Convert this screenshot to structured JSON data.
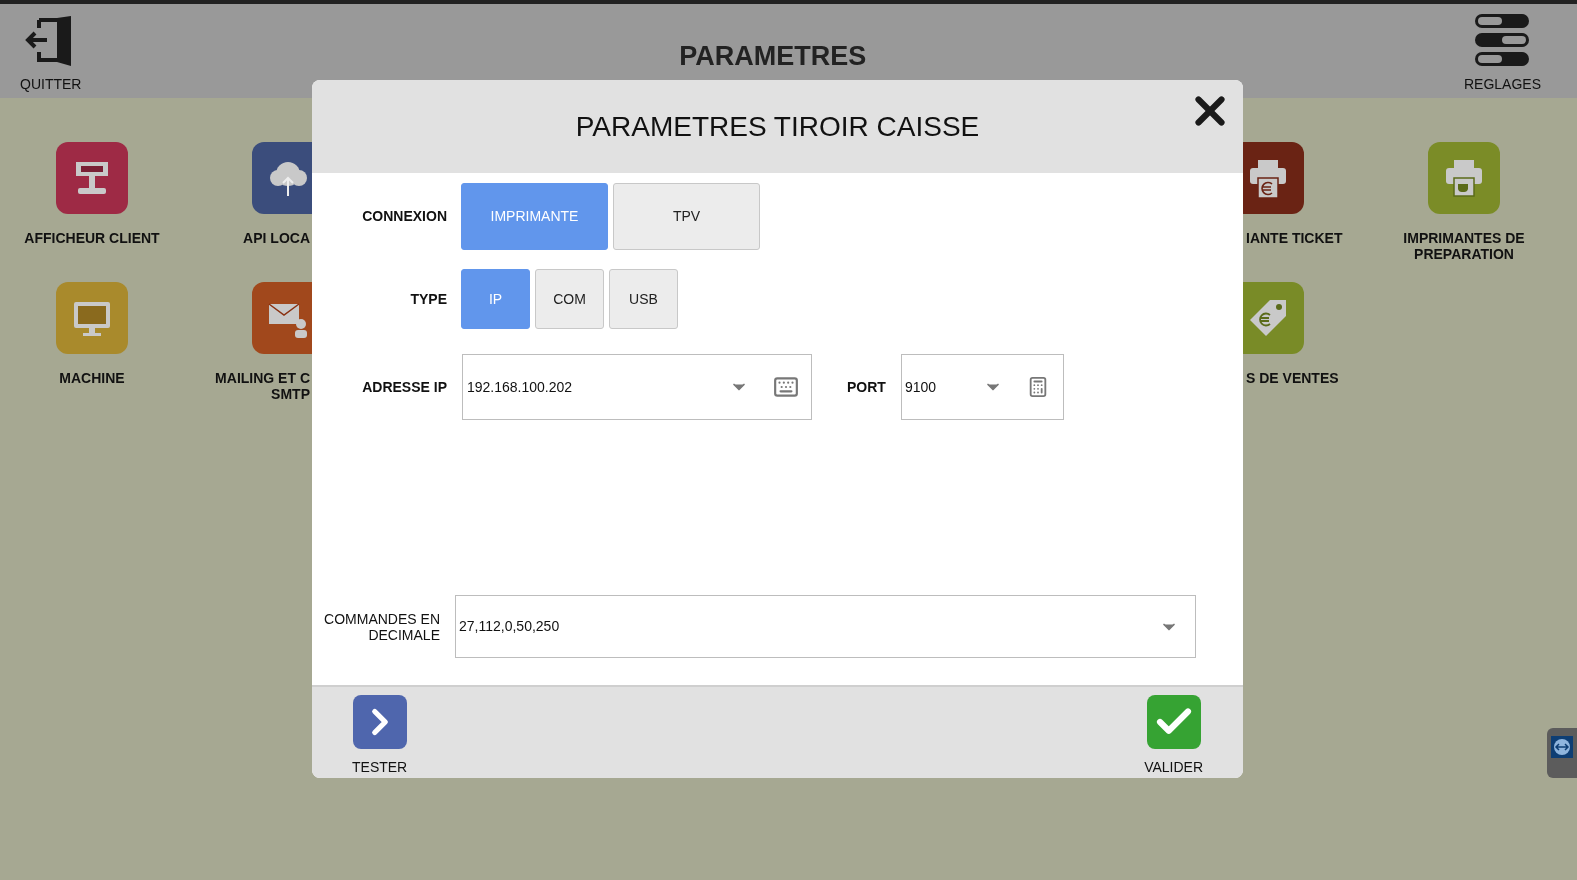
{
  "header": {
    "quit_label": "QUITTER",
    "title": "PARAMETRES",
    "settings_label": "REGLAGES"
  },
  "tile_rows": [
    {
      "left": [
        {
          "label": "AFFICHEUR CLIENT",
          "color": "#9e2a45"
        },
        {
          "label": "API LOCA",
          "color": "#3b4d7c"
        }
      ],
      "right": [
        {
          "label": "IANTE TICKET",
          "color": "#6a2314"
        },
        {
          "label": "IMPRIMANTES DE PREPARATION",
          "color": "#7b8c27"
        }
      ]
    },
    {
      "left": [
        {
          "label": "MACHINE",
          "color": "#a98a2c"
        },
        {
          "label": "MAILING ET C SMTP",
          "color": "#a1481c"
        }
      ],
      "right": [
        {
          "label": "S DE VENTES",
          "color": "#798b27"
        }
      ]
    }
  ],
  "dialog": {
    "title": "PARAMETRES TIROIR CAISSE",
    "connexion": {
      "label": "CONNEXION",
      "options": [
        {
          "label": "IMPRIMANTE",
          "selected": true
        },
        {
          "label": "TPV",
          "selected": false
        }
      ]
    },
    "type": {
      "label": "TYPE",
      "options": [
        {
          "label": "IP",
          "selected": true
        },
        {
          "label": "COM",
          "selected": false
        },
        {
          "label": "USB",
          "selected": false
        }
      ]
    },
    "ip": {
      "label": "ADRESSE IP",
      "value": "192.168.100.202"
    },
    "port": {
      "label": "PORT",
      "value": "9100"
    },
    "commands": {
      "label": "COMMANDES EN DECIMALE",
      "value": "27,112,0,50,250"
    },
    "footer_buttons": [
      {
        "kind": "test",
        "label": "TESTER"
      },
      {
        "kind": "validate",
        "label": "VALIDER"
      }
    ]
  }
}
